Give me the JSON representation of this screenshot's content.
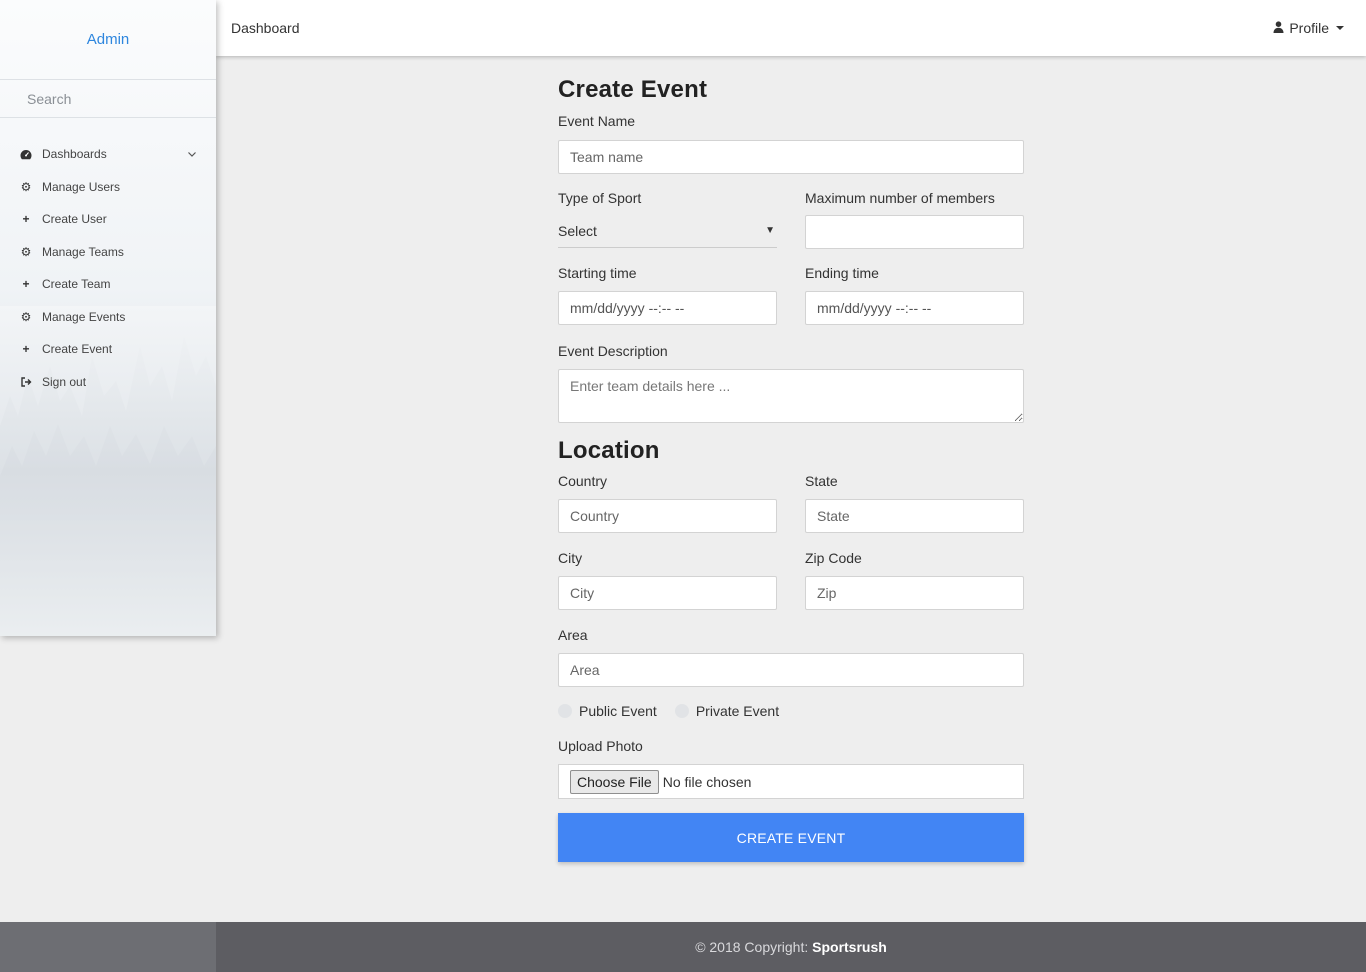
{
  "sidebar": {
    "brand": "Admin",
    "search_placeholder": "Search",
    "items": [
      {
        "label": "Dashboards",
        "icon": "dashboard-icon"
      },
      {
        "label": "Manage Users",
        "icon": "gear-icon"
      },
      {
        "label": "Create User",
        "icon": "plus-icon"
      },
      {
        "label": "Manage Teams",
        "icon": "gear-icon"
      },
      {
        "label": "Create Team",
        "icon": "plus-icon"
      },
      {
        "label": "Manage Events",
        "icon": "gear-icon"
      },
      {
        "label": "Create Event",
        "icon": "plus-icon"
      },
      {
        "label": "Sign out",
        "icon": "sign-out-icon"
      }
    ]
  },
  "topbar": {
    "title": "Dashboard",
    "profile": "Profile"
  },
  "form": {
    "heading": "Create Event",
    "event_name_label": "Event Name",
    "event_name_placeholder": "Team name",
    "sport_label": "Type of Sport",
    "sport_value": "Select",
    "max_members_label": "Maximum number of members",
    "max_members_value": "",
    "start_label": "Starting time",
    "start_placeholder": "mm/dd/yyyy --:-- --",
    "end_label": "Ending time",
    "end_placeholder": "mm/dd/yyyy --:-- --",
    "description_label": "Event Description",
    "description_placeholder": "Enter team details here ...",
    "location_heading": "Location",
    "country_label": "Country",
    "country_placeholder": "Country",
    "state_label": "State",
    "state_placeholder": "State",
    "city_label": "City",
    "city_placeholder": "City",
    "zip_label": "Zip Code",
    "zip_placeholder": "Zip",
    "area_label": "Area",
    "area_placeholder": "Area",
    "public_label": "Public Event",
    "private_label": "Private Event",
    "upload_label": "Upload Photo",
    "choose_file": "Choose File",
    "no_file": "No file chosen",
    "submit": "CREATE EVENT"
  },
  "footer": {
    "copyright": "© 2018 Copyright:",
    "brand": "Sportsrush"
  },
  "colors": {
    "accent": "#4285f4",
    "brand_link": "#2e86de",
    "footer_bg": "#5d5d62"
  }
}
